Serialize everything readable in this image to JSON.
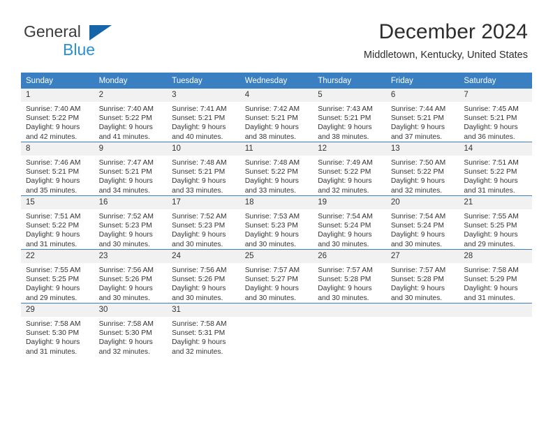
{
  "brand": {
    "name_top": "General",
    "name_bottom": "Blue",
    "triangle_icon": "brand-triangle-icon",
    "accent_color": "#1565a8",
    "blue_text_color": "#2b8fd6"
  },
  "header": {
    "title": "December 2024",
    "subtitle": "Middletown, Kentucky, United States"
  },
  "calendar": {
    "header_bg": "#3a7fc1",
    "header_text_color": "#ffffff",
    "daynum_bg": "#f1f1f1",
    "weekday_headers": [
      "Sunday",
      "Monday",
      "Tuesday",
      "Wednesday",
      "Thursday",
      "Friday",
      "Saturday"
    ],
    "weeks": [
      [
        {
          "day": "1",
          "sunrise": "Sunrise: 7:40 AM",
          "sunset": "Sunset: 5:22 PM",
          "daylight_line1": "Daylight: 9 hours",
          "daylight_line2": "and 42 minutes."
        },
        {
          "day": "2",
          "sunrise": "Sunrise: 7:40 AM",
          "sunset": "Sunset: 5:22 PM",
          "daylight_line1": "Daylight: 9 hours",
          "daylight_line2": "and 41 minutes."
        },
        {
          "day": "3",
          "sunrise": "Sunrise: 7:41 AM",
          "sunset": "Sunset: 5:21 PM",
          "daylight_line1": "Daylight: 9 hours",
          "daylight_line2": "and 40 minutes."
        },
        {
          "day": "4",
          "sunrise": "Sunrise: 7:42 AM",
          "sunset": "Sunset: 5:21 PM",
          "daylight_line1": "Daylight: 9 hours",
          "daylight_line2": "and 38 minutes."
        },
        {
          "day": "5",
          "sunrise": "Sunrise: 7:43 AM",
          "sunset": "Sunset: 5:21 PM",
          "daylight_line1": "Daylight: 9 hours",
          "daylight_line2": "and 38 minutes."
        },
        {
          "day": "6",
          "sunrise": "Sunrise: 7:44 AM",
          "sunset": "Sunset: 5:21 PM",
          "daylight_line1": "Daylight: 9 hours",
          "daylight_line2": "and 37 minutes."
        },
        {
          "day": "7",
          "sunrise": "Sunrise: 7:45 AM",
          "sunset": "Sunset: 5:21 PM",
          "daylight_line1": "Daylight: 9 hours",
          "daylight_line2": "and 36 minutes."
        }
      ],
      [
        {
          "day": "8",
          "sunrise": "Sunrise: 7:46 AM",
          "sunset": "Sunset: 5:21 PM",
          "daylight_line1": "Daylight: 9 hours",
          "daylight_line2": "and 35 minutes."
        },
        {
          "day": "9",
          "sunrise": "Sunrise: 7:47 AM",
          "sunset": "Sunset: 5:21 PM",
          "daylight_line1": "Daylight: 9 hours",
          "daylight_line2": "and 34 minutes."
        },
        {
          "day": "10",
          "sunrise": "Sunrise: 7:48 AM",
          "sunset": "Sunset: 5:21 PM",
          "daylight_line1": "Daylight: 9 hours",
          "daylight_line2": "and 33 minutes."
        },
        {
          "day": "11",
          "sunrise": "Sunrise: 7:48 AM",
          "sunset": "Sunset: 5:22 PM",
          "daylight_line1": "Daylight: 9 hours",
          "daylight_line2": "and 33 minutes."
        },
        {
          "day": "12",
          "sunrise": "Sunrise: 7:49 AM",
          "sunset": "Sunset: 5:22 PM",
          "daylight_line1": "Daylight: 9 hours",
          "daylight_line2": "and 32 minutes."
        },
        {
          "day": "13",
          "sunrise": "Sunrise: 7:50 AM",
          "sunset": "Sunset: 5:22 PM",
          "daylight_line1": "Daylight: 9 hours",
          "daylight_line2": "and 32 minutes."
        },
        {
          "day": "14",
          "sunrise": "Sunrise: 7:51 AM",
          "sunset": "Sunset: 5:22 PM",
          "daylight_line1": "Daylight: 9 hours",
          "daylight_line2": "and 31 minutes."
        }
      ],
      [
        {
          "day": "15",
          "sunrise": "Sunrise: 7:51 AM",
          "sunset": "Sunset: 5:22 PM",
          "daylight_line1": "Daylight: 9 hours",
          "daylight_line2": "and 31 minutes."
        },
        {
          "day": "16",
          "sunrise": "Sunrise: 7:52 AM",
          "sunset": "Sunset: 5:23 PM",
          "daylight_line1": "Daylight: 9 hours",
          "daylight_line2": "and 30 minutes."
        },
        {
          "day": "17",
          "sunrise": "Sunrise: 7:52 AM",
          "sunset": "Sunset: 5:23 PM",
          "daylight_line1": "Daylight: 9 hours",
          "daylight_line2": "and 30 minutes."
        },
        {
          "day": "18",
          "sunrise": "Sunrise: 7:53 AM",
          "sunset": "Sunset: 5:23 PM",
          "daylight_line1": "Daylight: 9 hours",
          "daylight_line2": "and 30 minutes."
        },
        {
          "day": "19",
          "sunrise": "Sunrise: 7:54 AM",
          "sunset": "Sunset: 5:24 PM",
          "daylight_line1": "Daylight: 9 hours",
          "daylight_line2": "and 30 minutes."
        },
        {
          "day": "20",
          "sunrise": "Sunrise: 7:54 AM",
          "sunset": "Sunset: 5:24 PM",
          "daylight_line1": "Daylight: 9 hours",
          "daylight_line2": "and 30 minutes."
        },
        {
          "day": "21",
          "sunrise": "Sunrise: 7:55 AM",
          "sunset": "Sunset: 5:25 PM",
          "daylight_line1": "Daylight: 9 hours",
          "daylight_line2": "and 29 minutes."
        }
      ],
      [
        {
          "day": "22",
          "sunrise": "Sunrise: 7:55 AM",
          "sunset": "Sunset: 5:25 PM",
          "daylight_line1": "Daylight: 9 hours",
          "daylight_line2": "and 29 minutes."
        },
        {
          "day": "23",
          "sunrise": "Sunrise: 7:56 AM",
          "sunset": "Sunset: 5:26 PM",
          "daylight_line1": "Daylight: 9 hours",
          "daylight_line2": "and 30 minutes."
        },
        {
          "day": "24",
          "sunrise": "Sunrise: 7:56 AM",
          "sunset": "Sunset: 5:26 PM",
          "daylight_line1": "Daylight: 9 hours",
          "daylight_line2": "and 30 minutes."
        },
        {
          "day": "25",
          "sunrise": "Sunrise: 7:57 AM",
          "sunset": "Sunset: 5:27 PM",
          "daylight_line1": "Daylight: 9 hours",
          "daylight_line2": "and 30 minutes."
        },
        {
          "day": "26",
          "sunrise": "Sunrise: 7:57 AM",
          "sunset": "Sunset: 5:28 PM",
          "daylight_line1": "Daylight: 9 hours",
          "daylight_line2": "and 30 minutes."
        },
        {
          "day": "27",
          "sunrise": "Sunrise: 7:57 AM",
          "sunset": "Sunset: 5:28 PM",
          "daylight_line1": "Daylight: 9 hours",
          "daylight_line2": "and 30 minutes."
        },
        {
          "day": "28",
          "sunrise": "Sunrise: 7:58 AM",
          "sunset": "Sunset: 5:29 PM",
          "daylight_line1": "Daylight: 9 hours",
          "daylight_line2": "and 31 minutes."
        }
      ],
      [
        {
          "day": "29",
          "sunrise": "Sunrise: 7:58 AM",
          "sunset": "Sunset: 5:30 PM",
          "daylight_line1": "Daylight: 9 hours",
          "daylight_line2": "and 31 minutes."
        },
        {
          "day": "30",
          "sunrise": "Sunrise: 7:58 AM",
          "sunset": "Sunset: 5:30 PM",
          "daylight_line1": "Daylight: 9 hours",
          "daylight_line2": "and 32 minutes."
        },
        {
          "day": "31",
          "sunrise": "Sunrise: 7:58 AM",
          "sunset": "Sunset: 5:31 PM",
          "daylight_line1": "Daylight: 9 hours",
          "daylight_line2": "and 32 minutes."
        },
        {
          "day": "",
          "sunrise": "",
          "sunset": "",
          "daylight_line1": "",
          "daylight_line2": ""
        },
        {
          "day": "",
          "sunrise": "",
          "sunset": "",
          "daylight_line1": "",
          "daylight_line2": ""
        },
        {
          "day": "",
          "sunrise": "",
          "sunset": "",
          "daylight_line1": "",
          "daylight_line2": ""
        },
        {
          "day": "",
          "sunrise": "",
          "sunset": "",
          "daylight_line1": "",
          "daylight_line2": ""
        }
      ]
    ]
  }
}
